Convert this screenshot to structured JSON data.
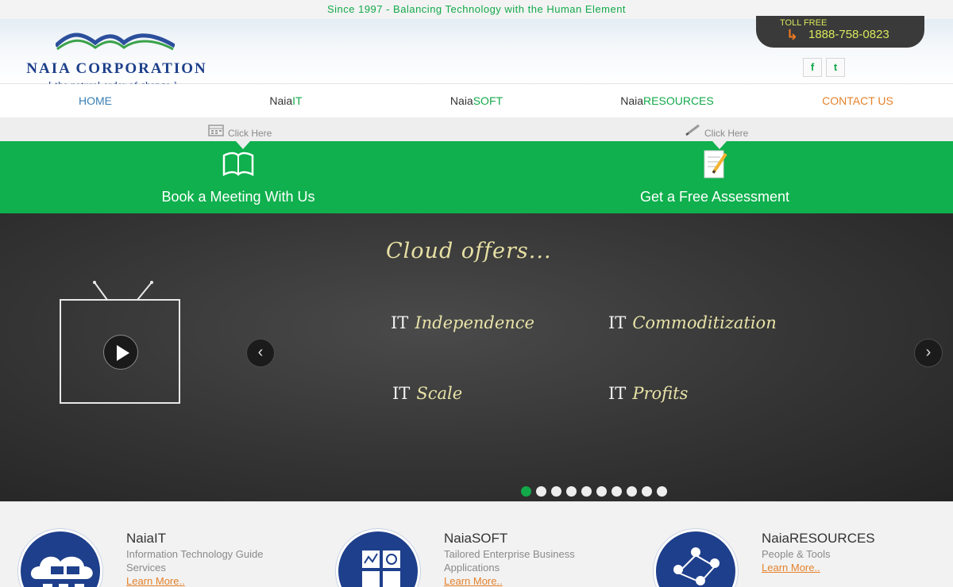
{
  "topbar": {
    "tagline": "Since 1997 - Balancing Technology with the Human Element"
  },
  "logo": {
    "name": "NAIA CORPORATION",
    "tagline": "[ the natural order of change ]"
  },
  "tollfree": {
    "label": "TOLL FREE",
    "number": "1888-758-0823"
  },
  "social": {
    "facebook": "f",
    "twitter": "t"
  },
  "nav": [
    {
      "prefix": "HOME",
      "suffix": ""
    },
    {
      "prefix": "Naia",
      "suffix": "IT"
    },
    {
      "prefix": "Naia",
      "suffix": "SOFT"
    },
    {
      "prefix": "Naia",
      "suffix": "RESOURCES"
    },
    {
      "prefix": "CONTACT US",
      "suffix": ""
    }
  ],
  "clickstrip": {
    "left": "Click Here",
    "right": "Click Here"
  },
  "cta": {
    "left": "Book a Meeting With Us",
    "right": "Get a Free Assessment"
  },
  "slider": {
    "title": "Cloud offers...",
    "items": [
      {
        "prefix": "IT",
        "word": "Independence"
      },
      {
        "prefix": "IT",
        "word": "Commoditization"
      },
      {
        "prefix": "IT",
        "word": "Scale"
      },
      {
        "prefix": "IT",
        "word": "Profits"
      }
    ],
    "prev": "‹",
    "next": "›",
    "dot_count": 10,
    "active_dot": 1
  },
  "services": [
    {
      "title": "NaiaIT",
      "desc": "Information Technology Guide Services",
      "link": "Learn More.."
    },
    {
      "title": "NaiaSOFT",
      "desc": "Tailored Enterprise Business Applications",
      "link": "Learn More.."
    },
    {
      "title": "NaiaRESOURCES",
      "desc": "People & Tools",
      "link": "Learn More.."
    }
  ],
  "colors": {
    "green": "#0fb04d",
    "orange": "#e5822b",
    "navy": "#1e3f8b",
    "blue_link": "#3a7fb3"
  },
  "icons": {
    "calendar": "calendar-icon",
    "pencil": "pencil-icon",
    "book": "open-book-icon",
    "notepad": "notepad-pencil-icon",
    "play": "play-icon",
    "phone_arrow": "arrow-icon"
  }
}
